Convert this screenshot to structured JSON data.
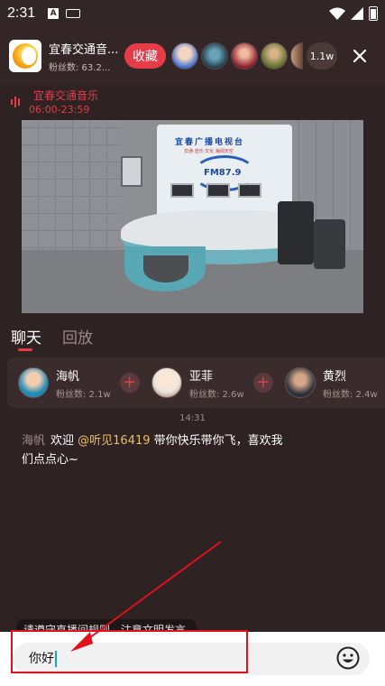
{
  "status_bar": {
    "time": "2:31",
    "a_badge": "A"
  },
  "header": {
    "station_name": "宜春交通音...",
    "station_fans": "粉丝数: 63.2...",
    "fav_label": "收藏",
    "listener_count": "1.1w"
  },
  "program": {
    "name": "宜春交通音乐",
    "time": "06:00-23:59"
  },
  "video": {
    "board_title": "宜春广播电视台",
    "board_sub": "交通·音乐·文化 海阔天空",
    "board_fm": "FM87.9"
  },
  "tabs": [
    {
      "label": "聊天"
    },
    {
      "label": "回放"
    }
  ],
  "hosts": [
    {
      "name": "海帆",
      "fans": "粉丝数: 2.1w"
    },
    {
      "name": "亚菲",
      "fans": "粉丝数: 2.6w"
    },
    {
      "name": "黄烈",
      "fans": "粉丝数: 2.4w"
    }
  ],
  "chat": {
    "timestamp": "14:31",
    "message": {
      "user": "海帆",
      "text_before": "欢迎 ",
      "mention": "@听见16419",
      "text_after": " 带你快乐带你飞，喜欢我们点点心~"
    }
  },
  "notice": "请遵守直播间规则，注意文明发言",
  "input": {
    "value": "你好"
  },
  "colors": {
    "accent": "#e53c48",
    "background": "#2e2222",
    "mention": "#e7c064",
    "annotation": "#e0111d"
  }
}
